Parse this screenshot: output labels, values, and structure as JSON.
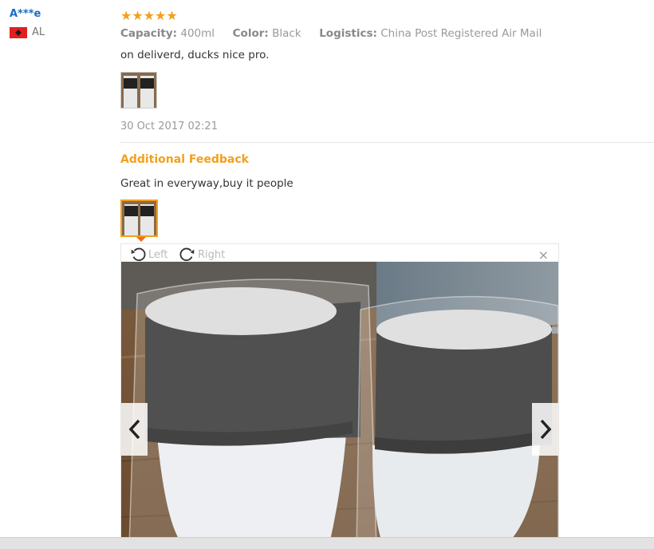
{
  "user": {
    "name": "A***e",
    "country_code": "AL"
  },
  "review": {
    "rating": 5,
    "stars": "★★★★★",
    "attributes": [
      {
        "label": "Capacity:",
        "value": "400ml"
      },
      {
        "label": "Color:",
        "value": "Black"
      },
      {
        "label": "Logistics:",
        "value": "China Post Registered Air Mail"
      }
    ],
    "text": "on deliverd, ducks nice pro.",
    "date": "30 Oct 2017 02:21"
  },
  "additional": {
    "title": "Additional Feedback",
    "text": "Great in everyway,buy it people"
  },
  "viewer": {
    "rotate_left_label": "Left",
    "rotate_right_label": "Right",
    "close_label": "×"
  },
  "colors": {
    "accent": "#f49f1c",
    "link": "#1a6cc4",
    "pointer": "#f26b1d"
  }
}
